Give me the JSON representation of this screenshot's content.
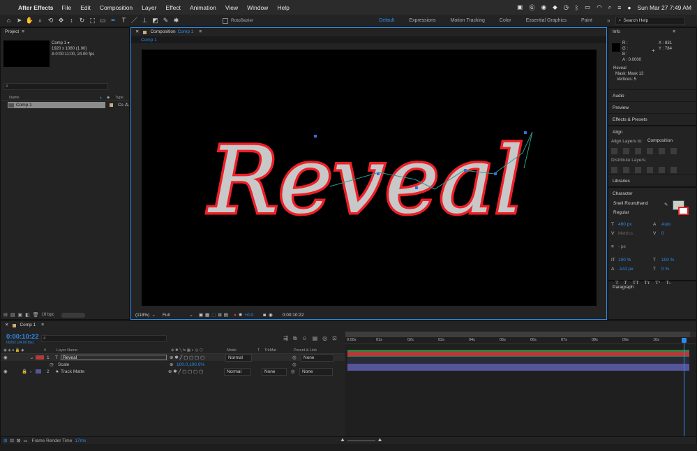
{
  "menubar": {
    "app": "After Effects",
    "items": [
      "File",
      "Edit",
      "Composition",
      "Layer",
      "Effect",
      "Animation",
      "View",
      "Window",
      "Help"
    ],
    "clock": "Sun Mar 27  7:49 AM"
  },
  "toolbar": {
    "rotobezier": "RotoBezier",
    "workspaces": [
      "Default",
      "Expressions",
      "Motion Tracking",
      "Color",
      "Essential Graphics",
      "Paint"
    ],
    "search_placeholder": "Search Help"
  },
  "project": {
    "title": "Project",
    "comp_name": "Comp 1 ▾",
    "comp_res": "1920 x 1080 (1.00)",
    "comp_dur": "Δ 0:00:11:00, 24.00 fps",
    "col_name": "Name",
    "col_type": "Type",
    "row_name": "Comp 1",
    "row_type": "Co",
    "bpc": "16 bpc"
  },
  "composition": {
    "title_prefix": "Composition",
    "title_name": "Comp 1",
    "tab": "Comp 1",
    "zoom": "(118%)",
    "resolution": "Full",
    "exposure": "+0.0",
    "timecode": "0:00:10:22",
    "canvas_text": "Reveal"
  },
  "info": {
    "title": "Info",
    "r": "R :",
    "g": "G :",
    "b": "B :",
    "a": "A : 0.0000",
    "x": "X : 831",
    "y": "Y : 784",
    "layer": "Reveal",
    "mask": "Mask: Mask 13",
    "vertices": "Vertices: 5"
  },
  "panels": {
    "audio": "Audio",
    "preview": "Preview",
    "effects": "Effects & Presets",
    "align": "Align",
    "align_to_label": "Align Layers to:",
    "align_to_value": "Composition",
    "distribute": "Distribute Layers:",
    "libraries": "Libraries",
    "character": "Character",
    "paragraph": "Paragraph"
  },
  "character": {
    "font": "Snell Roundhand",
    "style": "Regular",
    "size": "460 px",
    "leading": "Auto",
    "kerning": "Metrics",
    "tracking": "0",
    "stroke": "- px",
    "vscale": "100 %",
    "hscale": "100 %",
    "baseline": "-141 px",
    "tsume": "0 %",
    "fill_color": "#c6d2c9",
    "stroke_color": "#e8242a"
  },
  "timeline": {
    "tab": "Comp 1",
    "timecode": "0:00:10:22",
    "frames": "00262 (24.00 fps)",
    "col_layer": "Layer Name",
    "col_mode": "Mode",
    "col_t": "T",
    "col_trkmat": "TrkMat",
    "col_parent": "Parent & Link",
    "layer1_num": "1",
    "layer1_name": "Reveal",
    "layer1_mode": "Normal",
    "layer1_parent": "None",
    "scale_label": "Scale",
    "scale_value": "100.0,100.0%",
    "layer2_num": "2",
    "layer2_name": "Track Matte",
    "layer2_mode": "Normal",
    "layer2_trkmat": "None",
    "layer2_parent": "None",
    "ruler": [
      "0:00s",
      "01s",
      "02s",
      "03s",
      "04s",
      "05s",
      "06s",
      "07s",
      "08s",
      "09s",
      "10s"
    ],
    "render_label": "Frame Render Time",
    "render_value": "17ms"
  },
  "colors": {
    "accent": "#2d8ceb",
    "layer1_bar": "#b23a3a",
    "layer2_bar": "#55559a",
    "text_fill": "#c8c8c8",
    "text_stroke": "#ee1f27"
  }
}
